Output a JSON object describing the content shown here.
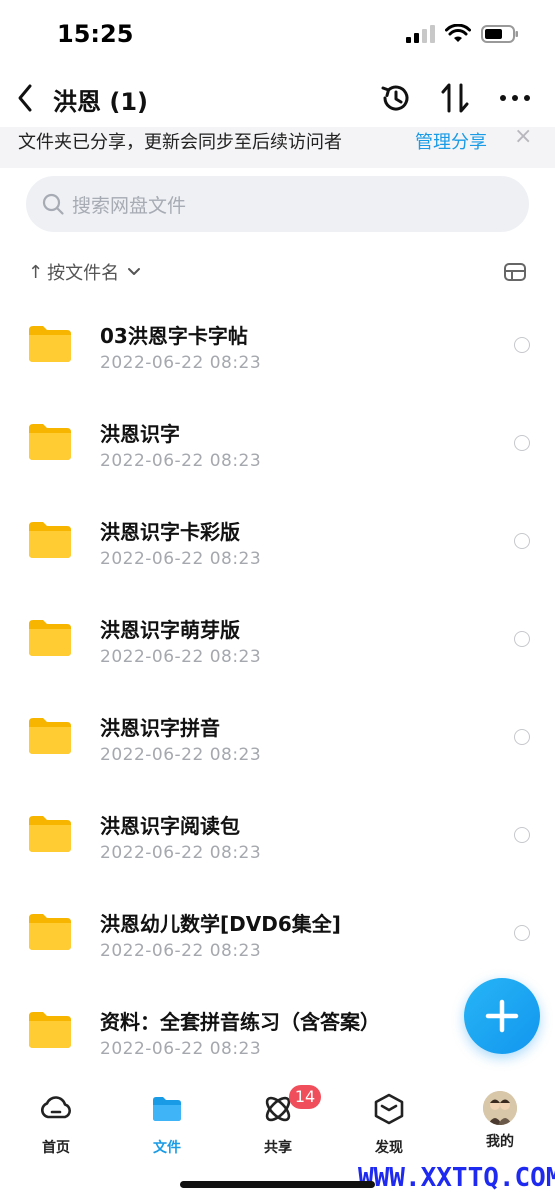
{
  "status_bar": {
    "time": "15:25"
  },
  "header": {
    "title": "洪恩 (1)"
  },
  "banner": {
    "text": "文件夹已分享，更新会同步至后续访问者",
    "link": "管理分享",
    "close": "×"
  },
  "search": {
    "placeholder": "搜索网盘文件"
  },
  "sort": {
    "arrow": "↑",
    "label": "按文件名"
  },
  "files": [
    {
      "name": "03洪恩字卡字帖",
      "date": "2022-06-22 08:23"
    },
    {
      "name": "洪恩识字",
      "date": "2022-06-22 08:23"
    },
    {
      "name": "洪恩识字卡彩版",
      "date": "2022-06-22 08:23"
    },
    {
      "name": "洪恩识字萌芽版",
      "date": "2022-06-22 08:23"
    },
    {
      "name": "洪恩识字拼音",
      "date": "2022-06-22 08:23"
    },
    {
      "name": "洪恩识字阅读包",
      "date": "2022-06-22 08:23"
    },
    {
      "name": "洪恩幼儿数学[DVD6集全]",
      "date": "2022-06-22 08:23"
    },
    {
      "name": "资料：全套拼音练习（含答案）",
      "date": "2022-06-22 08:23"
    }
  ],
  "tabs": [
    {
      "label": "首页",
      "icon": "cloud-icon"
    },
    {
      "label": "文件",
      "icon": "folder-icon"
    },
    {
      "label": "共享",
      "icon": "share-orbit-icon",
      "badge": "14"
    },
    {
      "label": "发现",
      "icon": "cube-icon"
    },
    {
      "label": "我的",
      "icon": "avatar"
    }
  ],
  "watermark": "WWW.XXTTQ.COM",
  "colors": {
    "accent": "#1a9be6",
    "folder": "#ffc524",
    "badge": "#ef4e5a"
  }
}
